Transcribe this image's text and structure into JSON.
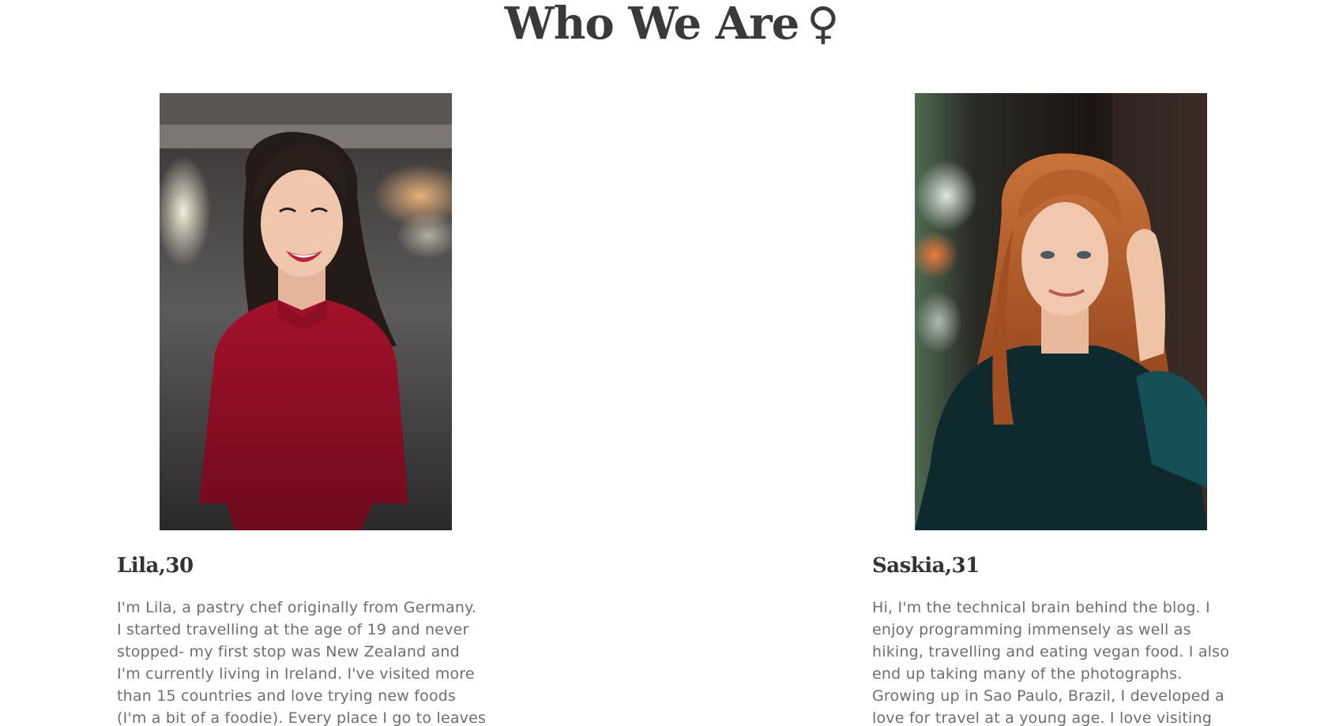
{
  "section": {
    "title": "Who We Are",
    "title_symbol": "♀"
  },
  "profiles": [
    {
      "name": "Lila,30",
      "photo_icon": "portrait-woman-red-dress",
      "bio_lines": [
        "I'm Lila, a pastry chef originally from Germany.",
        "I started travelling at the age of 19 and never",
        "stopped- my first stop was New Zealand and",
        "I'm currently living in Ireland. I've visited more",
        "than 15 countries and love trying new foods",
        "(I'm a bit of a foodie). Every place I go to leaves"
      ]
    },
    {
      "name": "Saskia,31",
      "photo_icon": "portrait-woman-red-hair",
      "bio_lines": [
        "Hi, I'm the technical brain behind the blog. I",
        "enjoy programming immensely as well as",
        "hiking, travelling and eating vegan food. I also",
        "end up taking many of the photographs.",
        "Growing up in Sao Paulo, Brazil, I developed a",
        "love for travel at a young age. I love visiting"
      ]
    }
  ],
  "colors": {
    "heading": "#3a3a3a",
    "body_text": "#6e6e6e",
    "background": "#ffffff"
  }
}
